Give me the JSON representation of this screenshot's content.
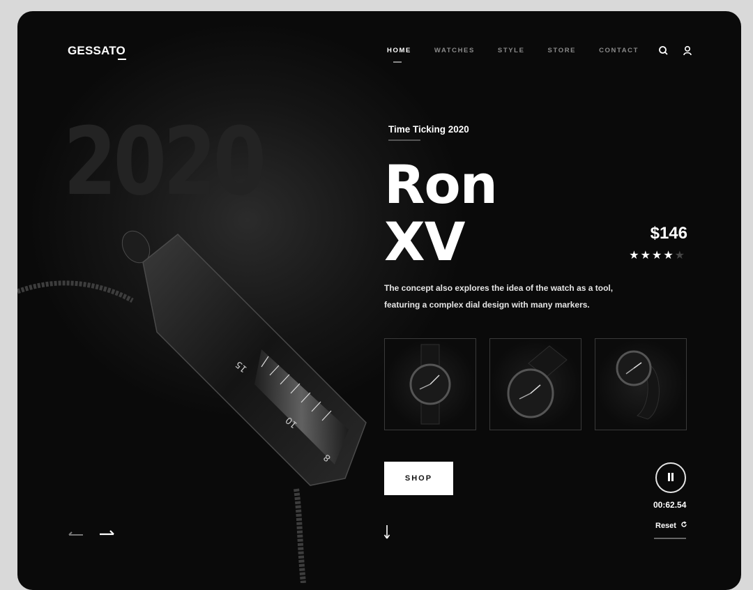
{
  "brand": {
    "logo": "GESSATO"
  },
  "nav": [
    {
      "label": "HOME",
      "active": true
    },
    {
      "label": "WATCHES",
      "active": false
    },
    {
      "label": "STYLE",
      "active": false
    },
    {
      "label": "STORE",
      "active": false
    },
    {
      "label": "CONTACT",
      "active": false
    }
  ],
  "header_icons": [
    "search-icon",
    "user-icon"
  ],
  "hero": {
    "year": "2020",
    "subtitle": "Time Ticking 2020",
    "title_line1": "Ron",
    "title_line2": "XV",
    "price": "$146",
    "rating": 4,
    "rating_max": 5,
    "description_line1": "The concept also explores the idea of the watch as a tool,",
    "description_line2": "featuring a complex dial design with many markers.",
    "watch_scale_numbers": [
      "15",
      "10",
      "8"
    ]
  },
  "gallery": [
    "watch-front-thumbnail",
    "watch-angled-thumbnail",
    "watch-side-thumbnail"
  ],
  "actions": {
    "shop_label": "SHOP"
  },
  "player": {
    "timer": "00:62.54",
    "reset_label": "Reset"
  },
  "colors": {
    "background": "#0b0b0b",
    "accent": "#ffffff",
    "frame": "#d9d9d9"
  }
}
